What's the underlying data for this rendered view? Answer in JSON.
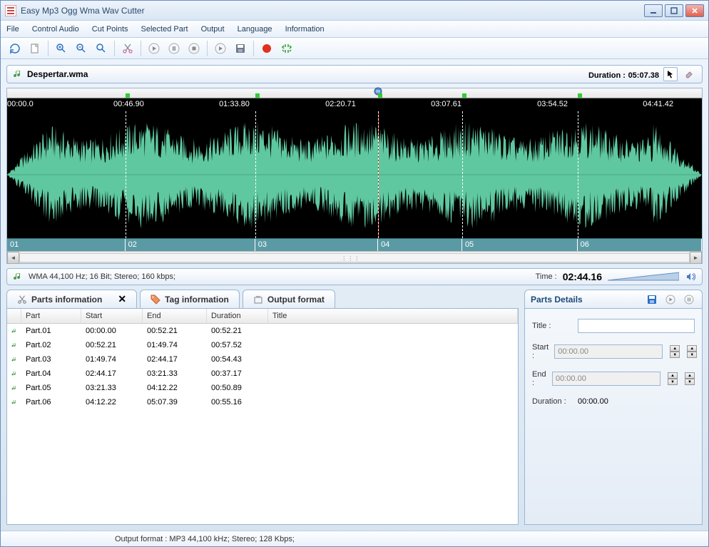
{
  "window": {
    "title": "Easy Mp3 Ogg Wma Wav Cutter"
  },
  "menu": [
    "File",
    "Control Audio",
    "Cut Points",
    "Selected Part",
    "Output",
    "Language",
    "Information"
  ],
  "file": {
    "name": "Despertar.wma",
    "duration_label": "Duration :",
    "duration": "05:07.38"
  },
  "timeline": {
    "ticks": [
      {
        "label": "00:00.0",
        "pct": 0
      },
      {
        "label": "00:46.90",
        "pct": 15.3
      },
      {
        "label": "01:33.80",
        "pct": 30.5
      },
      {
        "label": "02:20.71",
        "pct": 45.8
      },
      {
        "label": "03:07.61",
        "pct": 61.0
      },
      {
        "label": "03:54.52",
        "pct": 76.3
      },
      {
        "label": "04:41.42",
        "pct": 91.5
      }
    ],
    "playhead_pct": 53.4,
    "cuts_pct": [
      17.0,
      35.7,
      53.4,
      65.5,
      82.1
    ],
    "part_labels": [
      "01",
      "02",
      "03",
      "04",
      "05",
      "06"
    ],
    "part_bounds_pct": [
      0,
      17.0,
      35.7,
      53.4,
      65.5,
      82.1,
      100
    ]
  },
  "format": {
    "text": "WMA 44,100 Hz; 16 Bit; Stereo; 160 kbps;",
    "time_label": "Time :",
    "time_value": "02:44.16"
  },
  "tabs": {
    "parts": "Parts information",
    "tag": "Tag information",
    "output": "Output format"
  },
  "table": {
    "headers": {
      "part": "Part",
      "start": "Start",
      "end": "End",
      "duration": "Duration",
      "title": "Title"
    },
    "rows": [
      {
        "part": "Part.01",
        "start": "00:00.00",
        "end": "00:52.21",
        "duration": "00:52.21",
        "title": ""
      },
      {
        "part": "Part.02",
        "start": "00:52.21",
        "end": "01:49.74",
        "duration": "00:57.52",
        "title": ""
      },
      {
        "part": "Part.03",
        "start": "01:49.74",
        "end": "02:44.17",
        "duration": "00:54.43",
        "title": ""
      },
      {
        "part": "Part.04",
        "start": "02:44.17",
        "end": "03:21.33",
        "duration": "00:37.17",
        "title": ""
      },
      {
        "part": "Part.05",
        "start": "03:21.33",
        "end": "04:12.22",
        "duration": "00:50.89",
        "title": ""
      },
      {
        "part": "Part.06",
        "start": "04:12.22",
        "end": "05:07.39",
        "duration": "00:55.16",
        "title": ""
      }
    ]
  },
  "details": {
    "header": "Parts Details",
    "title_label": "Title :",
    "start_label": "Start :",
    "end_label": "End :",
    "duration_label": "Duration :",
    "title_value": "",
    "start_value": "00:00.00",
    "end_value": "00:00.00",
    "duration_value": "00:00.00"
  },
  "status": {
    "text": "Output format : MP3 44,100 kHz; Stereo;  128 Kbps;"
  }
}
